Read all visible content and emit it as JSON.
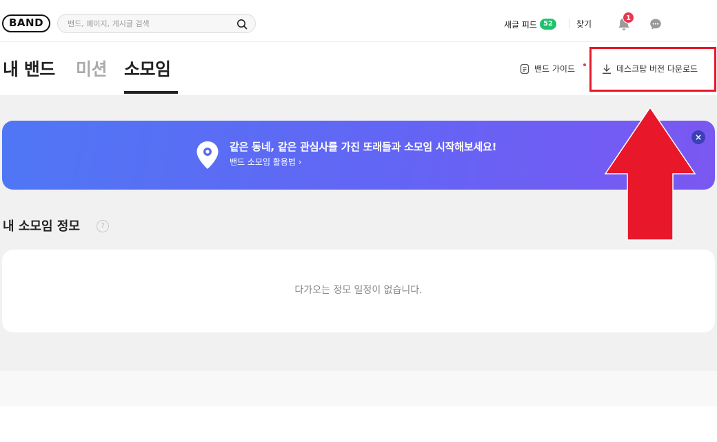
{
  "header": {
    "logo": "BAND",
    "search_placeholder": "밴드, 페이지, 게시글 검색",
    "feed_label": "새글 피드",
    "feed_count": "52",
    "find_label": "찾기",
    "notification_count": "1"
  },
  "tabs": {
    "items": [
      {
        "label": "내 밴드",
        "active": false
      },
      {
        "label": "미션",
        "active": false
      },
      {
        "label": "소모임",
        "active": true
      }
    ],
    "guide_label": "밴드 가이드",
    "download_label": "데스크탑 버전 다운로드"
  },
  "banner": {
    "title": "같은 동네, 같은 관심사를 가진 또래들과 소모임 시작해보세요!",
    "link": "밴드 소모임 활용법 ›",
    "close": "×"
  },
  "section": {
    "title": "내 소모임 정모",
    "help": "?",
    "empty_text": "다가오는 정모 일정이 없습니다."
  },
  "colors": {
    "accent_green": "#1cc36b",
    "badge_red": "#e8374f",
    "banner_start": "#4f77f5",
    "banner_end": "#7b57f2",
    "annotation_red": "#e8172a"
  }
}
